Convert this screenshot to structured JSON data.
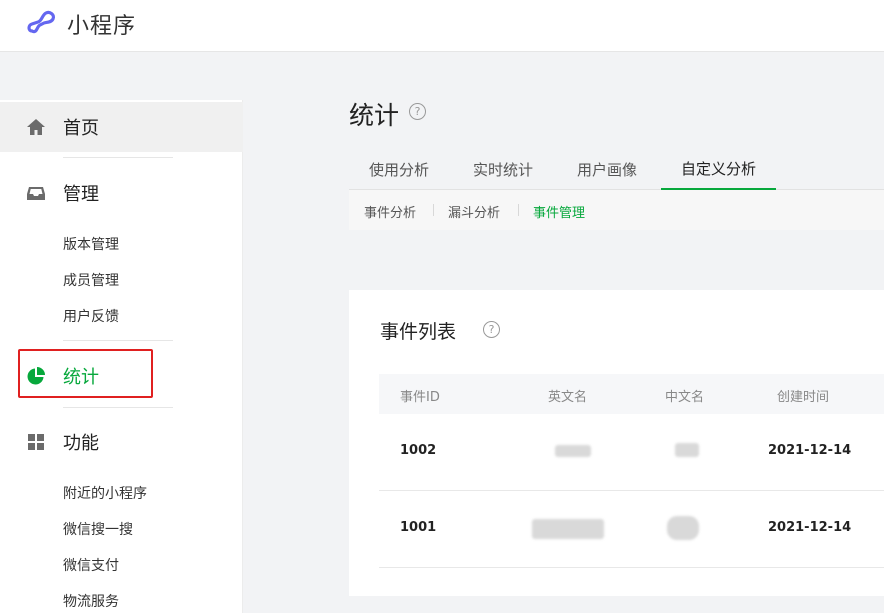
{
  "header": {
    "app_name": "小程序",
    "logo_icon": "miniprogram-logo-icon",
    "accent_color": "#6467f0"
  },
  "sidebar": {
    "home": {
      "label": "首页",
      "icon": "home-icon"
    },
    "manage": {
      "label": "管理",
      "icon": "inbox-icon",
      "items": [
        "版本管理",
        "成员管理",
        "用户反馈"
      ]
    },
    "stats": {
      "label": "统计",
      "icon": "pie-chart-icon"
    },
    "features": {
      "label": "功能",
      "icon": "grid-icon",
      "items": [
        "附近的小程序",
        "微信搜一搜",
        "微信支付",
        "物流服务"
      ]
    }
  },
  "main": {
    "title": "统计",
    "help": "?",
    "tabs": [
      "使用分析",
      "实时统计",
      "用户画像",
      "自定义分析"
    ],
    "subtabs": [
      "事件分析",
      "漏斗分析",
      "事件管理"
    ],
    "card": {
      "title": "事件列表",
      "columns": [
        "事件ID",
        "英文名",
        "中文名",
        "创建时间"
      ],
      "rows": [
        {
          "id": "1002",
          "created": "2021-12-14"
        },
        {
          "id": "1001",
          "created": "2021-12-14"
        }
      ]
    }
  },
  "colors": {
    "active_green": "#07a83c",
    "highlight_red": "#e02020"
  }
}
